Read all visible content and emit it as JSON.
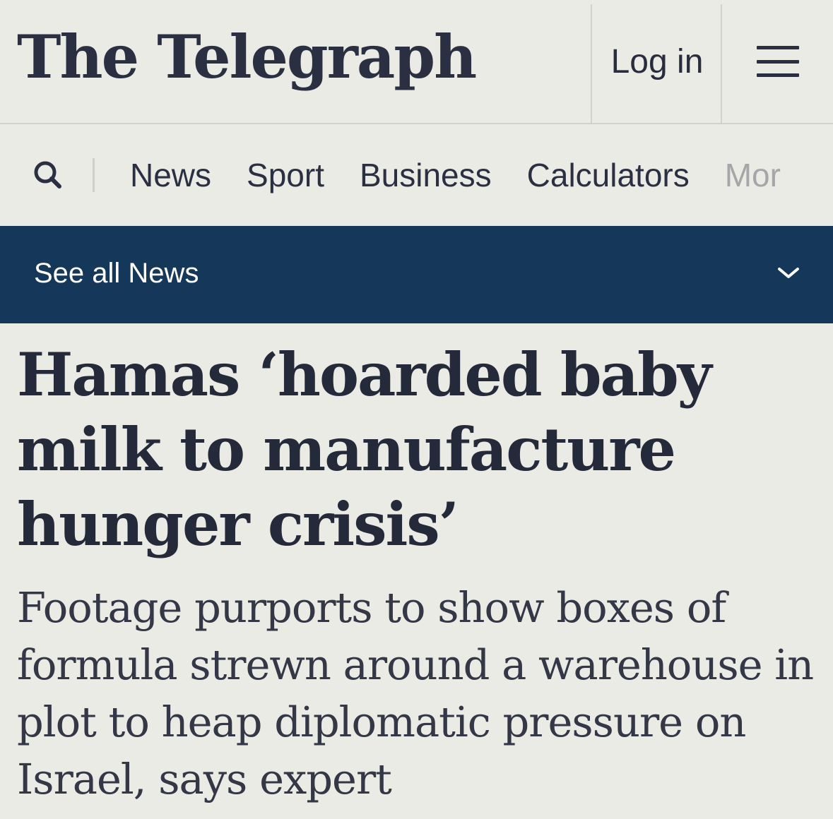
{
  "header": {
    "logo": "The Telegraph",
    "login_label": "Log in",
    "menu_icon": "hamburger-menu-icon"
  },
  "nav": {
    "search_icon": "search-icon",
    "items": [
      {
        "label": "News"
      },
      {
        "label": "Sport"
      },
      {
        "label": "Business"
      },
      {
        "label": "Calculators"
      },
      {
        "label": "Mor"
      }
    ]
  },
  "section_bar": {
    "label": "See all News",
    "icon": "chevron-down-icon",
    "color": "#15375a"
  },
  "article": {
    "headline": "Hamas ‘hoarded baby milk to manufacture hunger crisis’",
    "standfirst": "Footage purports to show boxes of formula strewn around a warehouse in plot to heap diplomatic pressure on Israel, says expert"
  }
}
